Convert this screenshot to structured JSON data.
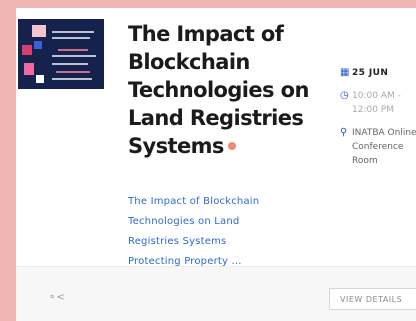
{
  "event": {
    "title": "The Impact of Blockchain Technologies on Land Registries Systems",
    "description": "The Impact of Blockchain Technologies on Land Registries Systems Protecting Property ..."
  },
  "meta": {
    "date": "25 JUN",
    "time": "10:00 AM - 12:00 PM",
    "venue": "INATBA Online Conference Room"
  },
  "footer": {
    "view_label": "VIEW DETAILS"
  },
  "icons": {
    "date": "calendar-icon",
    "time": "clock-icon",
    "venue": "location-pin-icon",
    "share": "share-icon"
  },
  "colors": {
    "page_background": "#efb6b4",
    "accent_blue": "#2f55c9",
    "link_blue": "#2b6bd1",
    "title_dot": "#f08a6e",
    "thumbnail_navy": "#16224e"
  }
}
